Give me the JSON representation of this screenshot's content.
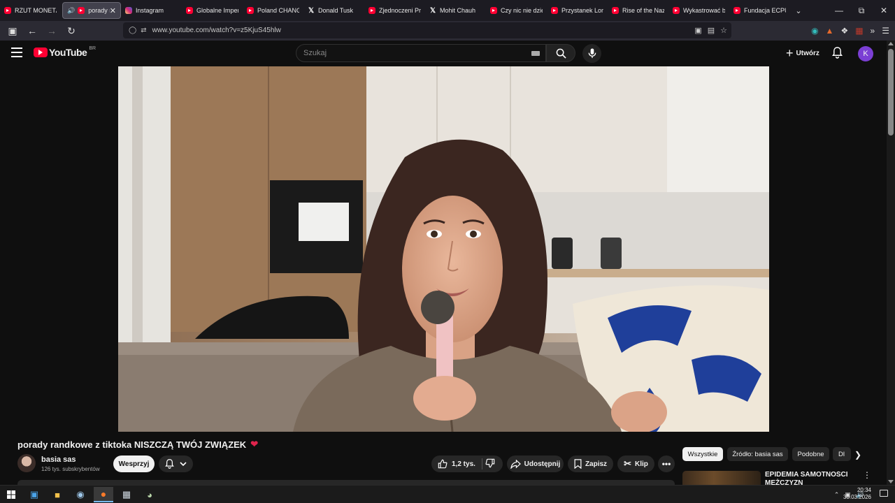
{
  "browser": {
    "tabs": [
      {
        "label": "RZUT MONETĄ |",
        "icon": "youtube-icon"
      },
      {
        "label": "porady ra",
        "icon": "youtube-icon",
        "active": true
      },
      {
        "label": "Instagram",
        "icon": "instagram-icon"
      },
      {
        "label": "Globalne Imperi",
        "icon": "youtube-icon"
      },
      {
        "label": "Poland CHANGE",
        "icon": "youtube-icon"
      },
      {
        "label": "Donald Tusk",
        "icon": "x-icon"
      },
      {
        "label": "Zjednoczeni Prze",
        "icon": "youtube-icon"
      },
      {
        "label": "Mohit Chauh",
        "icon": "x-icon"
      },
      {
        "label": "Czy nic nie dzieje",
        "icon": "youtube-icon"
      },
      {
        "label": "Przystanek Lomb",
        "icon": "youtube-icon"
      },
      {
        "label": "Rise of the Nazis",
        "icon": "youtube-icon"
      },
      {
        "label": "Wykastrować be",
        "icon": "youtube-icon"
      },
      {
        "label": "Fundacja ECPU P",
        "icon": "youtube-icon"
      }
    ],
    "url": "www.youtube.com/watch?v=z5KjuS45hlw"
  },
  "youtube": {
    "logo_text": "YouTube",
    "logo_region": "BR",
    "search_placeholder": "Szukaj",
    "create_label": "Utwórz",
    "avatar_letter": "K"
  },
  "video": {
    "title": "porady randkowe z tiktoka NISZCZĄ TWÓJ ZWIĄZEK",
    "channel_name": "basia sas",
    "subscribers": "126 tys. subskrybentów",
    "join_label": "Wesprzyj",
    "likes": "1,2 tys.",
    "share_label": "Udostępnij",
    "save_label": "Zapisz",
    "clip_label": "Klip"
  },
  "sidebar": {
    "chips": [
      "Wszystkie",
      "Źródło: basia sas",
      "Podobne",
      "Dl"
    ],
    "recommended_title": "EPIDEMIA SAMOTNOŚCI MĘŻCZYZN"
  },
  "taskbar": {
    "time": "20:34",
    "date": "30.03.2026"
  }
}
